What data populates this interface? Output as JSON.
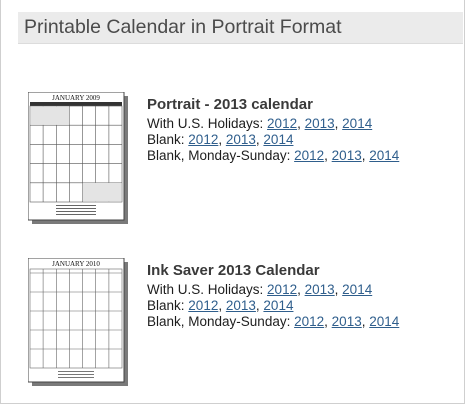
{
  "page": {
    "title": "Printable Calendar in Portrait Format"
  },
  "sections": [
    {
      "thumbnail_month": "JANUARY 2009",
      "title": "Portrait - 2013 calendar",
      "rows": [
        {
          "label": "With U.S. Holidays:",
          "links": [
            "2012",
            "2013",
            "2014"
          ]
        },
        {
          "label": "Blank:",
          "links": [
            "2012",
            "2013",
            "2014"
          ]
        },
        {
          "label": "Blank, Monday-Sunday:",
          "links": [
            "2012",
            "2013",
            "2014"
          ]
        }
      ]
    },
    {
      "thumbnail_month": "JANUARY 2010",
      "title": "Ink Saver 2013 Calendar",
      "rows": [
        {
          "label": "With U.S. Holidays:",
          "links": [
            "2012",
            "2013",
            "2014"
          ]
        },
        {
          "label": "Blank:",
          "links": [
            "2012",
            "2013",
            "2014"
          ]
        },
        {
          "label": "Blank, Monday-Sunday:",
          "links": [
            "2012",
            "2013",
            "2014"
          ]
        }
      ]
    }
  ],
  "colors": {
    "link": "#2f5e8c",
    "header_bg": "#ebebeb",
    "header_text": "#4b4b4b"
  }
}
